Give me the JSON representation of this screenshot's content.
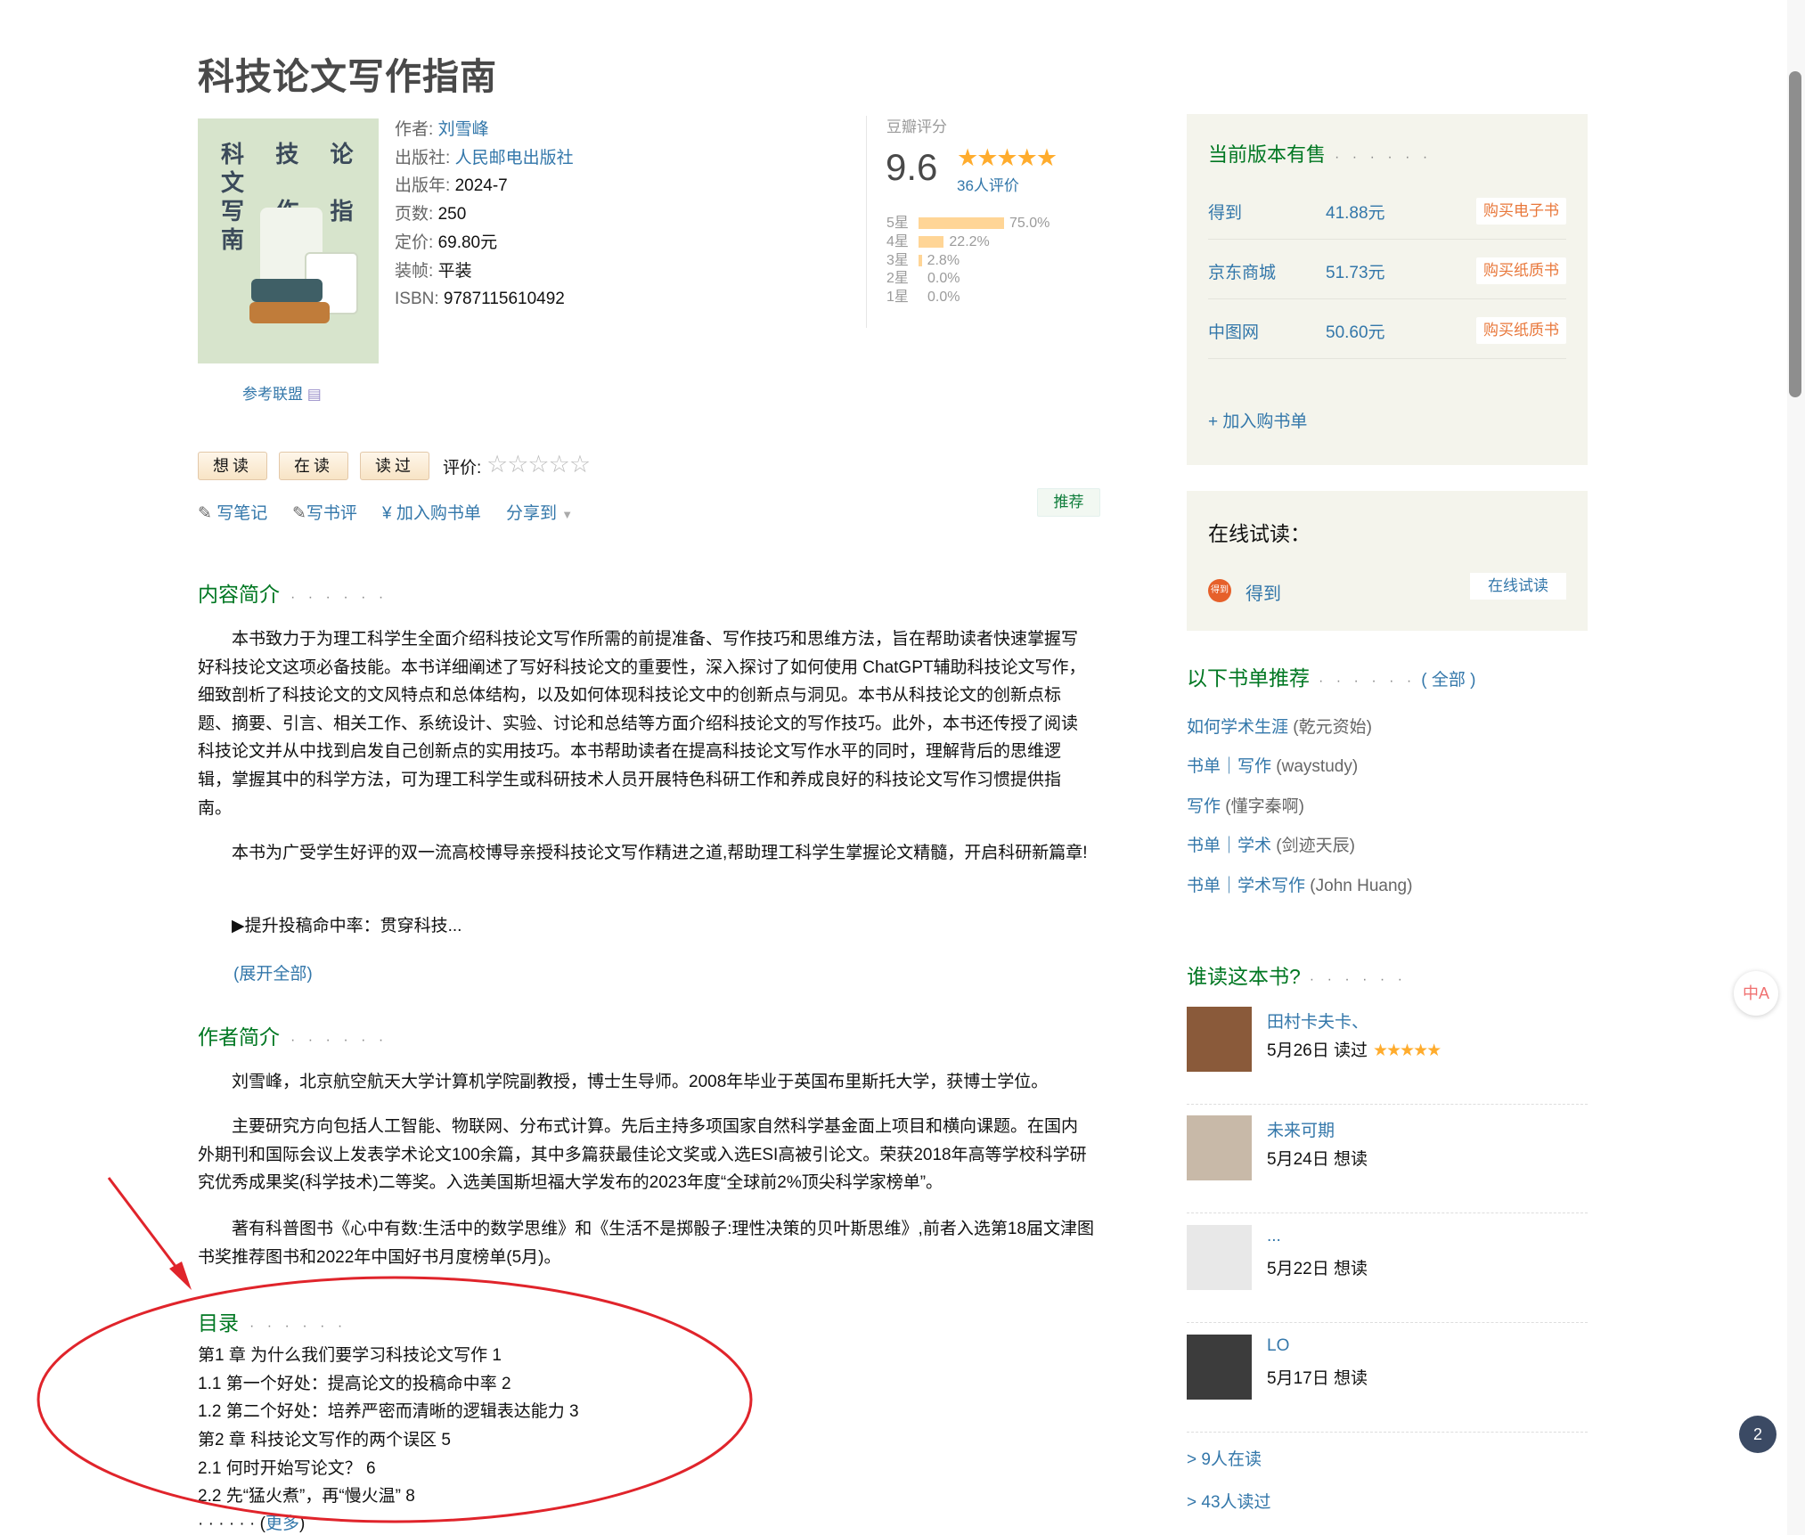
{
  "book": {
    "title": "科技论文写作指南",
    "cover_title_line1": "科 技 论 文",
    "cover_title_line2": "写 作 指 南",
    "ref_union": "参考联盟",
    "info": {
      "author_label": "作者:",
      "author": "刘雪峰",
      "publisher_label": "出版社:",
      "publisher": "人民邮电出版社",
      "year_label": "出版年:",
      "year": "2024-7",
      "pages_label": "页数:",
      "pages": "250",
      "price_label": "定价:",
      "price": "69.80元",
      "binding_label": "装帧:",
      "binding": "平装",
      "isbn_label": "ISBN:",
      "isbn": "9787115610492"
    }
  },
  "rating": {
    "label": "豆瓣评分",
    "score": "9.6",
    "stars": "★★★★★",
    "count": "36人评价",
    "distribution": [
      {
        "star": "5星",
        "pct": "75.0%",
        "value": 75.0
      },
      {
        "star": "4星",
        "pct": "22.2%",
        "value": 22.2
      },
      {
        "star": "3星",
        "pct": "2.8%",
        "value": 2.8
      },
      {
        "star": "2星",
        "pct": "0.0%",
        "value": 0.0
      },
      {
        "star": "1星",
        "pct": "0.0%",
        "value": 0.0
      }
    ]
  },
  "actions": {
    "want": "想读",
    "reading": "在读",
    "read": "读过",
    "rate_label": "评价:",
    "rate_stars": "☆☆☆☆☆",
    "write_note": "写笔记",
    "write_review": "写书评",
    "add_booklist": "¥ 加入购书单",
    "share": "分享到",
    "recommend": "推荐"
  },
  "intro": {
    "heading": "内容简介",
    "dots": "· · · · · ·",
    "p1": "本书致力于为理工科学生全面介绍科技论文写作所需的前提准备、写作技巧和思维方法，旨在帮助读者快速掌握写好科技论文这项必备技能。本书详细阐述了写好科技论文的重要性，深入探讨了如何使用 ChatGPT辅助科技论文写作，细致剖析了科技论文的文风特点和总体结构，以及如何体现科技论文中的创新点与洞见。本书从科技论文的创新点标题、摘要、引言、相关工作、系统设计、实验、讨论和总结等方面介绍科技论文的写作技巧。此外，本书还传授了阅读科技论文并从中找到启发自己创新点的实用技巧。本书帮助读者在提高科技论文写作水平的同时，理解背后的思维逻辑，掌握其中的科学方法，可为理工科学生或科研技术人员开展特色科研工作和养成良好的科技论文写作习惯提供指南。",
    "p2": "本书为广受学生好评的双一流高校博导亲授科技论文写作精进之道,帮助理工科学生掌握论文精髓，开启科研新篇章!",
    "p3": "▶提升投稿命中率：贯穿科技...",
    "expand": "(展开全部)"
  },
  "author_intro": {
    "heading": "作者简介",
    "dots": "· · · · · ·",
    "p1": "刘雪峰，北京航空航天大学计算机学院副教授，博士生导师。2008年毕业于英国布里斯托大学，获博士学位。",
    "p2": "主要研究方向包括人工智能、物联网、分布式计算。先后主持多项国家自然科学基金面上项目和横向课题。在国内外期刊和国际会议上发表学术论文100余篇，其中多篇获最佳论文奖或入选ESI高被引论文。荣获2018年高等学校科学研究优秀成果奖(科学技术)二等奖。入选美国斯坦福大学发布的2023年度“全球前2%顶尖科学家榜单”。",
    "p3": "著有科普图书《心中有数:生活中的数学思维》和《生活不是掷骰子:理性决策的贝叶斯思维》,前者入选第18届文津图书奖推荐图书和2022年中国好书月度榜单(5月)。"
  },
  "toc": {
    "heading": "目录",
    "dots": "· · · · · ·",
    "lines": [
      "第1 章 为什么我们要学习科技论文写作 1",
      "1.1 第一个好处：提高论文的投稿命中率 2",
      "1.2 第二个好处：培养严密而清晰的逻辑表达能力 3",
      "第2 章 科技论文写作的两个误区 5",
      "2.1 何时开始写论文？ 6",
      "2.2 先“猛火煮”，再“慢火温” 8"
    ],
    "more_dots": "· · · · · · (",
    "more": "更多",
    "more_close": ")"
  },
  "buy": {
    "title": "当前版本有售",
    "dots": "· · · · · ·",
    "rows": [
      {
        "vendor": "得到",
        "price": "41.88元",
        "button": "购买电子书"
      },
      {
        "vendor": "京东商城",
        "price": "51.73元",
        "button": "购买纸质书"
      },
      {
        "vendor": "中图网",
        "price": "50.60元",
        "button": "购买纸质书"
      }
    ],
    "add_booklist": "+ 加入购书单"
  },
  "trial": {
    "title": "在线试读：",
    "icon_text": "得到",
    "vendor": "得到",
    "button": "在线试读"
  },
  "booklists": {
    "title": "以下书单推荐",
    "dots": "· · · · · ·",
    "all_open": "(",
    "all": "全部",
    "all_close": ")",
    "items": [
      {
        "title": "如何学术生涯",
        "owner": " (乾元资始)"
      },
      {
        "title": "书单｜写作",
        "owner": " (waystudy)"
      },
      {
        "title": "写作",
        "owner": " (懂字秦啊)"
      },
      {
        "title": "书单｜学术",
        "owner": " (剑迹天辰)"
      },
      {
        "title": "书单｜学术写作",
        "owner": " (John Huang)"
      }
    ]
  },
  "readers": {
    "title": "谁读这本书?",
    "dots": "· · · · · ·",
    "items": [
      {
        "name": "田村卡夫卡、",
        "status": "5月26日 读过",
        "stars": "★★★★★"
      },
      {
        "name": "未来可期",
        "status": "5月24日 想读",
        "stars": ""
      },
      {
        "name": "...",
        "status": "5月22日 想读",
        "stars": ""
      },
      {
        "name": "LO",
        "status": "5月17日 想读",
        "stars": ""
      }
    ],
    "reading_link": "> 9人在读",
    "read_link": "> 43人读过"
  },
  "floating": {
    "translate": "中A",
    "page_badge": "2"
  },
  "colors": {
    "link": "#3377aa",
    "section_green": "#007722",
    "star_orange": "#ffac2d",
    "annotation_red": "#e0242b"
  }
}
